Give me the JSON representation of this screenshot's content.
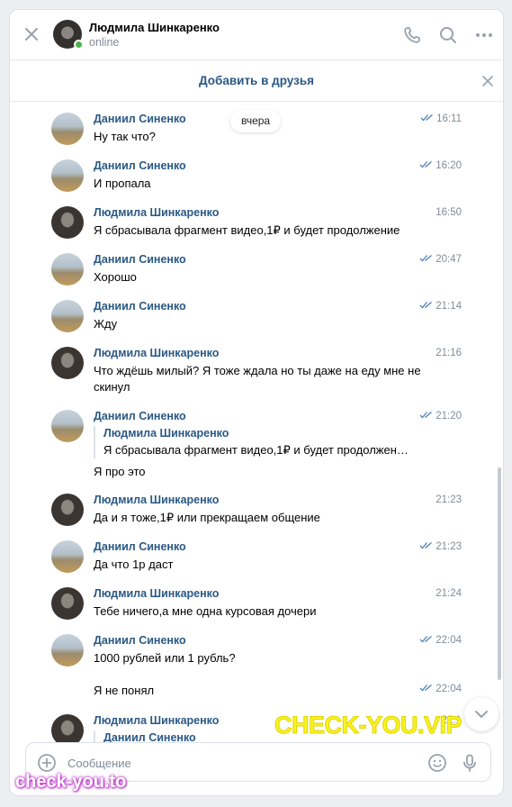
{
  "header": {
    "name": "Людмила Шинкаренко",
    "status": "online"
  },
  "friend_bar": {
    "label": "Добавить в друзья"
  },
  "date_separator": "вчера",
  "messages": [
    {
      "sender": "Даниил Синенко",
      "time": "16:11",
      "text": "Ну так что?"
    },
    {
      "sender": "Даниил Синенко",
      "time": "16:20",
      "text": "И пропала"
    },
    {
      "sender": "Людмила Шинкаренко",
      "time": "16:50",
      "text": "Я сбрасывала фрагмент видео,1₽ и будет продолжение"
    },
    {
      "sender": "Даниил Синенко",
      "time": "20:47",
      "text": "Хорошо"
    },
    {
      "sender": "Даниил Синенко",
      "time": "21:14",
      "text": "Жду"
    },
    {
      "sender": "Людмила Шинкаренко",
      "time": "21:16",
      "text": "Что ждёшь милый? Я тоже ждала но ты даже на еду мне не скинул"
    },
    {
      "sender": "Даниил Синенко",
      "time": "21:20",
      "quote_sender": "Людмила Шинкаренко",
      "quote_text": "Я сбрасывала фрагмент видео,1₽ и будет продолжен…",
      "text": "Я про это"
    },
    {
      "sender": "Людмила Шинкаренко",
      "time": "21:23",
      "text": "Да и я тоже,1₽ или прекращаем общение"
    },
    {
      "sender": "Даниил Синенко",
      "time": "21:23",
      "text": "Да что 1р даст"
    },
    {
      "sender": "Людмила Шинкаренко",
      "time": "21:24",
      "text": "Тебе ничего,а мне одна курсовая дочери"
    },
    {
      "sender": "Даниил Синенко",
      "time": "22:04",
      "text": "1000 рублей или 1 рубль?"
    },
    {
      "time": "22:04",
      "text": "Я не понял"
    },
    {
      "sender": "Людмила Шинкаренко",
      "time": "22:1",
      "quote_sender": "Даниил Синенко"
    }
  ],
  "composer": {
    "placeholder": "Сообщение"
  },
  "watermarks": {
    "big": "CHECK-YOU.VIP",
    "small": "check-you.to"
  },
  "colors": {
    "link": "#2a5885",
    "muted": "#818c99",
    "accent": "#5181b8",
    "online": "#4bb34b"
  }
}
